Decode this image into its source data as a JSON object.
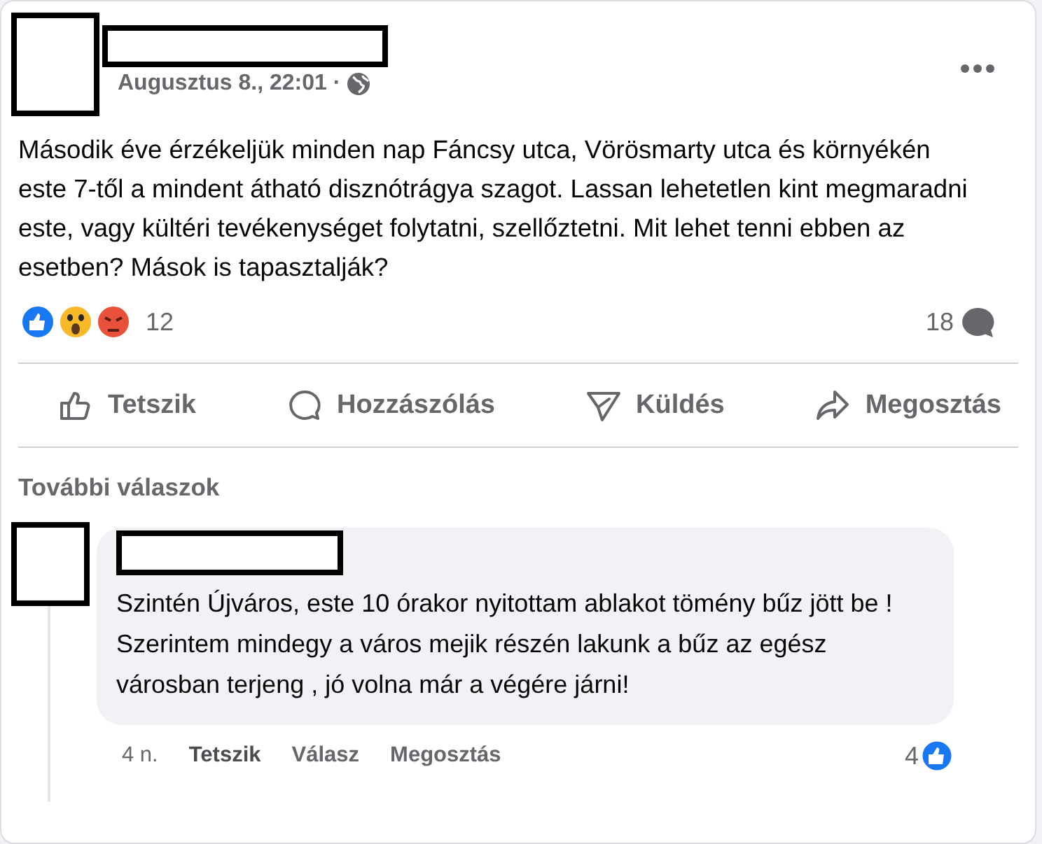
{
  "post": {
    "timestamp": "Augusztus 8., 22:01 ·",
    "text": "Második éve érzékeljük minden nap Fáncsy utca, Vörösmarty utca és környékén este 7-től a mindent átható disznótrágya szagot. Lassan lehetetlen kint megmaradni este, vagy kültéri tevékenységet folytatni, szellőztetni. Mit lehet tenni ebben az esetben? Mások is tapasztalják?",
    "reaction_count": "12",
    "comment_count": "18",
    "actions": [
      {
        "label": "Tetszik",
        "kind": "like"
      },
      {
        "label": "Hozzászólás",
        "kind": "comment"
      },
      {
        "label": "Küldés",
        "kind": "send"
      },
      {
        "label": "Megosztás",
        "kind": "share"
      }
    ]
  },
  "replies": {
    "label": "További válaszok",
    "comments": [
      {
        "text": "Szintén Újváros, este 10 órakor nyitottam ablakot tömény bűz jött be ! Szerintem mindegy a város mejik részén lakunk a bűz az egész városban terjeng , jó volna már a végére járni!",
        "time": "4 n.",
        "like_count": "4",
        "actions": [
          {
            "label": "Tetszik",
            "kind": "like"
          },
          {
            "label": "Válasz",
            "kind": "reply"
          },
          {
            "label": "Megosztás",
            "kind": "share"
          }
        ]
      }
    ]
  }
}
